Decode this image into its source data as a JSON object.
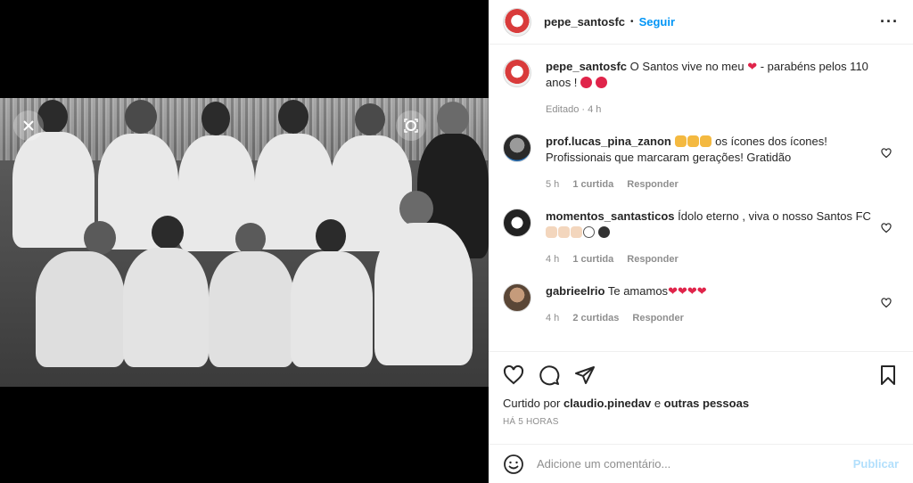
{
  "post": {
    "username": "pepe_santosfc",
    "follow_label": "Seguir",
    "caption_text": "O Santos vive no meu",
    "caption_text2": "- parabéns pelos 110 anos !",
    "caption_meta": "Editado · 4 h"
  },
  "comments": [
    {
      "user": "prof.lucas_pina_zanon",
      "text": "os ícones dos ícones! Profissionais que marcaram gerações! Gratidão",
      "time": "5 h",
      "likes": "1 curtida",
      "reply": "Responder"
    },
    {
      "user": "momentos_santasticos",
      "text": "Ídolo eterno , viva o nosso Santos FC",
      "time": "4 h",
      "likes": "1 curtida",
      "reply": "Responder"
    },
    {
      "user": "gabrieelrio",
      "text": "Te amamos",
      "time": "4 h",
      "likes": "2 curtidas",
      "reply": "Responder"
    }
  ],
  "actions": {
    "liked_prefix": "Curtido por",
    "liked_user": "claudio.pinedav",
    "liked_suffix": "e",
    "liked_others": "outras pessoas",
    "timestamp": "HÁ 5 HORAS"
  },
  "add_comment": {
    "placeholder": "Adicione um comentário...",
    "publish_label": "Publicar"
  },
  "colors": {
    "link_blue": "#0095f6",
    "publish_disabled": "#b2dffc",
    "heart_red": "#e0244a"
  },
  "icons": [
    "close-icon",
    "scan-icon",
    "more-icon",
    "heart-icon",
    "comment-icon",
    "share-icon",
    "bookmark-icon",
    "smile-icon"
  ]
}
